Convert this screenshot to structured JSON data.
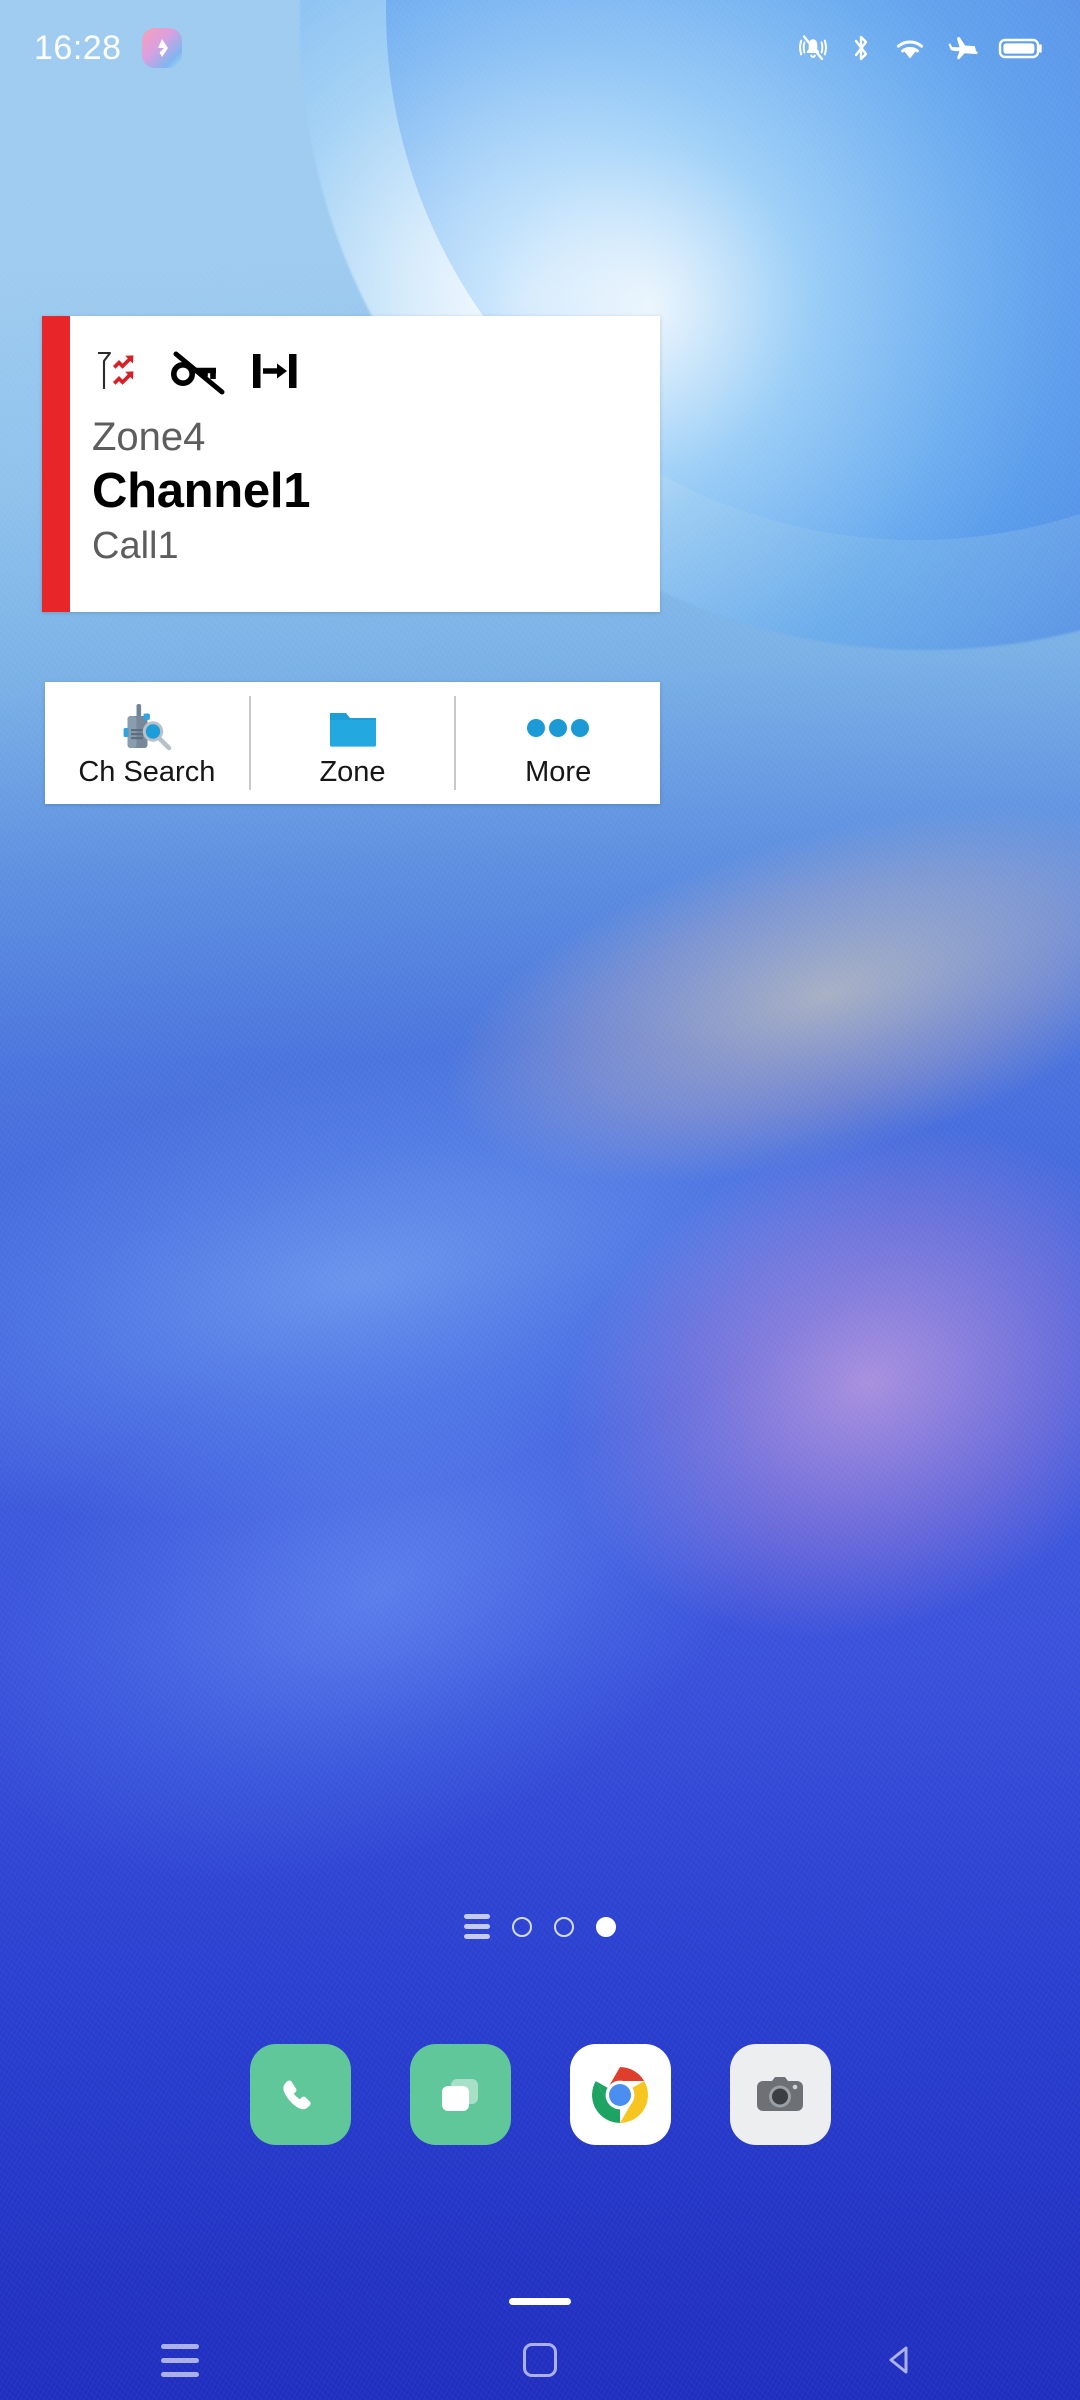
{
  "status_bar": {
    "time": "16:28",
    "left_icons": [
      {
        "name": "app-notification-icon",
        "label": "app-badge"
      }
    ],
    "right_icons": [
      {
        "name": "vibrate-mute-icon",
        "label": "Ringer silenced / vibrate"
      },
      {
        "name": "bluetooth-icon",
        "label": "Bluetooth"
      },
      {
        "name": "wifi-icon",
        "label": "Wi-Fi"
      },
      {
        "name": "airplane-mode-icon",
        "label": "Airplane mode"
      },
      {
        "name": "battery-icon",
        "label": "Battery full"
      }
    ]
  },
  "widget": {
    "accent_color": "#e8262a",
    "status_icons": [
      {
        "name": "antenna-signal-icon",
        "label": "Antenna / RSSI",
        "color": "#d81f26"
      },
      {
        "name": "no-encryption-key-icon",
        "label": "Encryption off"
      },
      {
        "name": "narrow-bandwidth-icon",
        "label": "Narrow band"
      }
    ],
    "zone": "Zone4",
    "channel": "Channel1",
    "call": "Call1",
    "actions": [
      {
        "label": "Ch Search",
        "icon": "radio-search-icon"
      },
      {
        "label": "Zone",
        "icon": "folder-icon"
      },
      {
        "label": "More",
        "icon": "more-dots-icon"
      }
    ],
    "icon_accent": "#1b9ad6"
  },
  "page_indicator": {
    "pages": 3,
    "active_index": 2,
    "has_app_drawer_glyph": true
  },
  "dock": {
    "apps": [
      {
        "name": "phone",
        "label": "Phone",
        "bg": "#5fc79a"
      },
      {
        "name": "messages",
        "label": "Messages",
        "bg": "#5fc79a"
      },
      {
        "name": "chrome",
        "label": "Chrome",
        "bg": "#ffffff"
      },
      {
        "name": "camera",
        "label": "Camera",
        "bg": "#eceef0"
      }
    ]
  },
  "navbar": {
    "buttons": [
      {
        "name": "recents",
        "label": "Recents"
      },
      {
        "name": "home",
        "label": "Home"
      },
      {
        "name": "back",
        "label": "Back"
      }
    ]
  }
}
